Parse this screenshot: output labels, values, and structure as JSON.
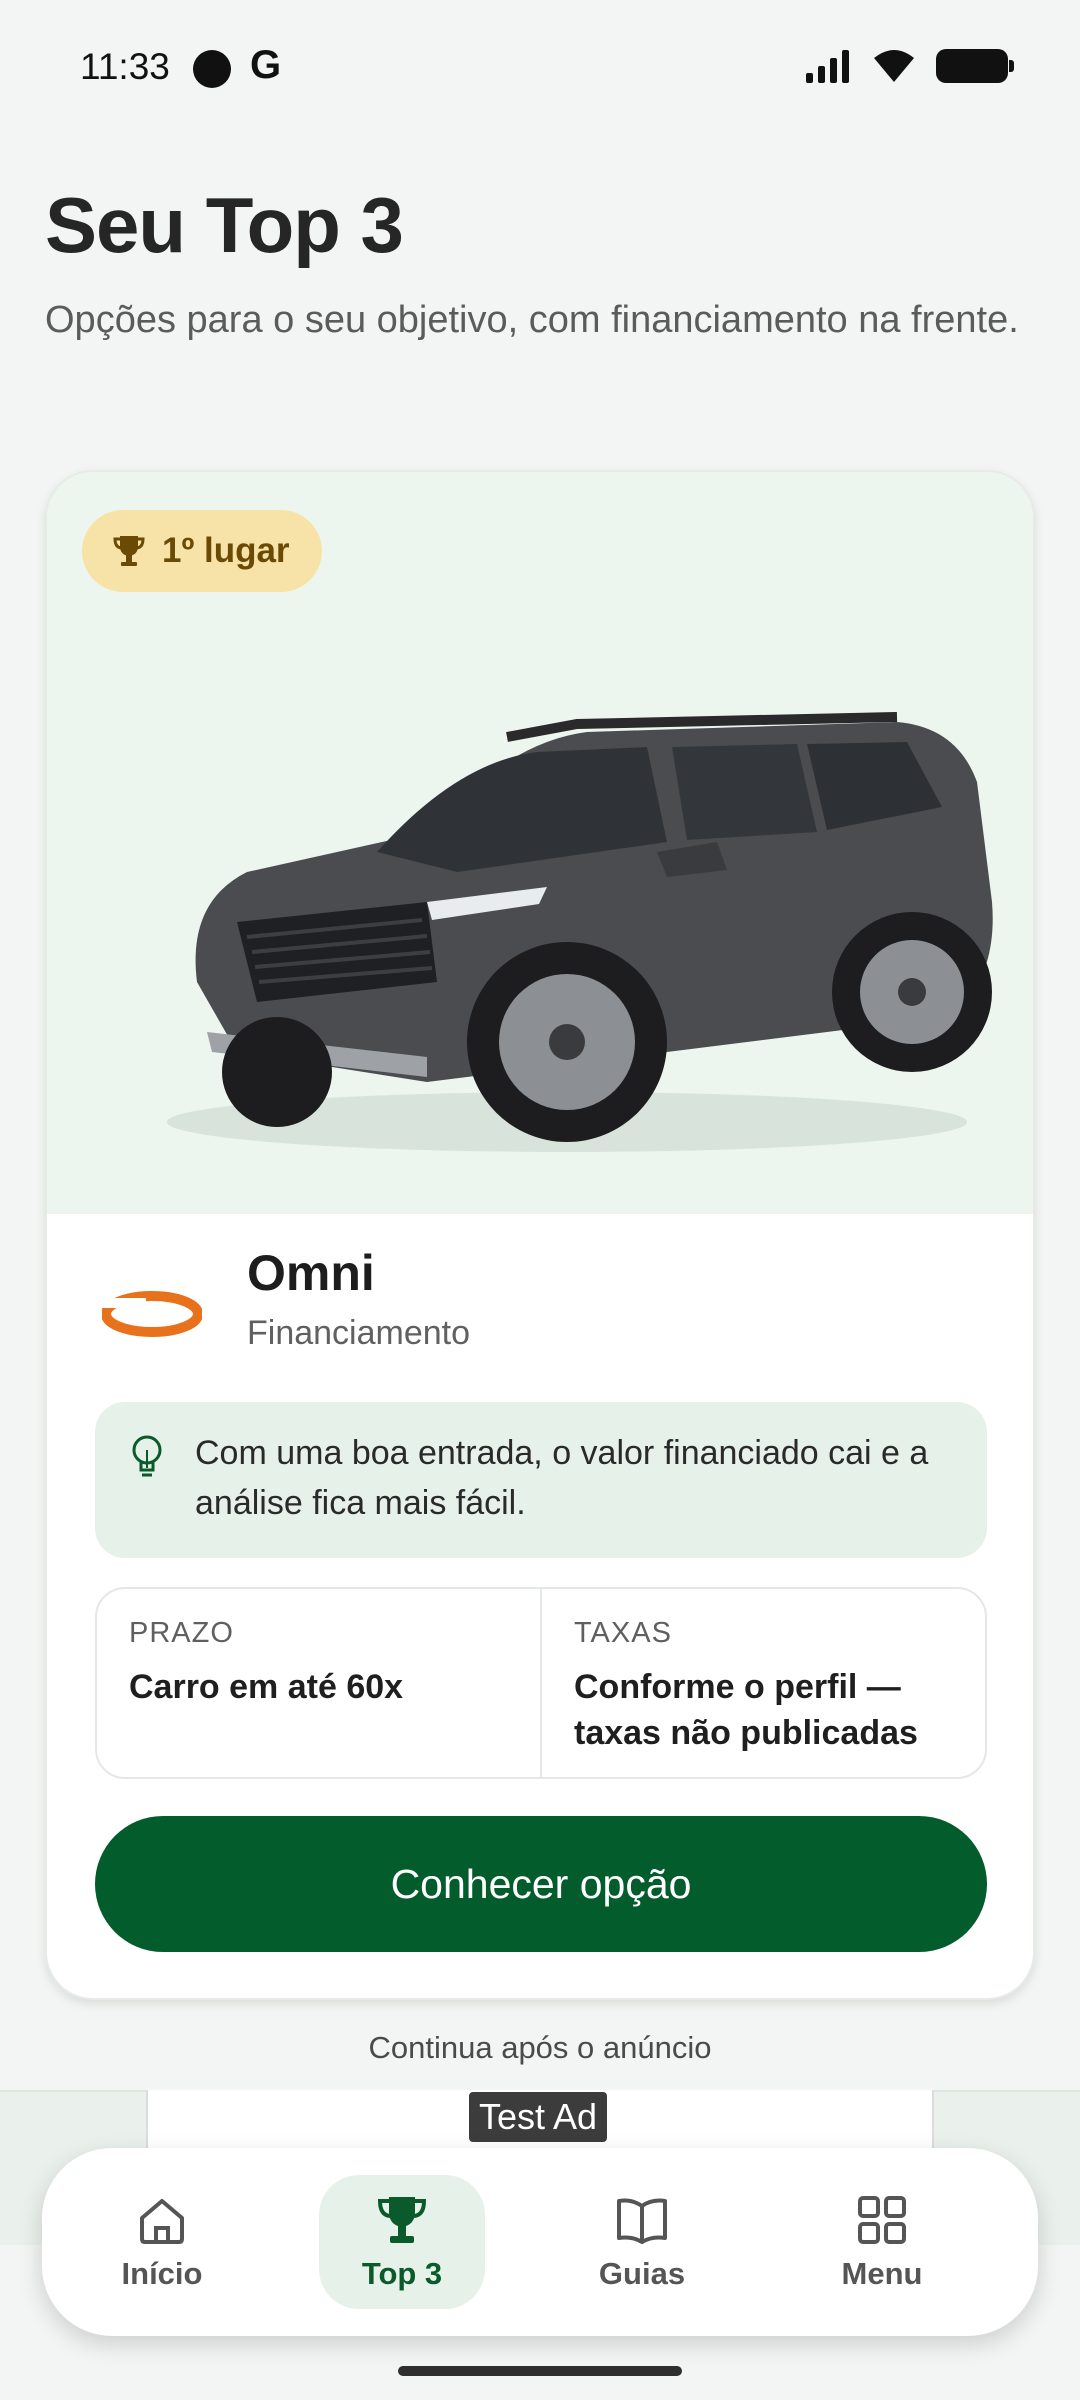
{
  "status_bar": {
    "time": "11:33",
    "g_label": "G"
  },
  "header": {
    "title": "Seu Top 3",
    "subtitle": "Opções para o seu objetivo, com financiamento na frente."
  },
  "card": {
    "rank_badge": "1º lugar",
    "car_image_icon": "suv-car-image",
    "provider_name": "Omni",
    "provider_type": "Financiamento",
    "tip": "Com uma boa entrada, o valor financiado cai e a análise fica mais fácil.",
    "info": [
      {
        "label": "PRAZO",
        "value": "Carro em até 60x"
      },
      {
        "label": "TAXAS",
        "value": "Conforme o perfil — taxas não publicadas"
      }
    ],
    "cta_label": "Conhecer opção"
  },
  "continue_note": "Continua após o anúncio",
  "ad": {
    "label": "Test Ad"
  },
  "nav": {
    "items": [
      {
        "label": "Início",
        "icon": "home-icon"
      },
      {
        "label": "Top 3",
        "icon": "trophy-icon"
      },
      {
        "label": "Guias",
        "icon": "book-icon"
      },
      {
        "label": "Menu",
        "icon": "grid-icon"
      }
    ]
  },
  "colors": {
    "brand_green": "#035c2c",
    "badge_gold": "#f7e3a8",
    "hero_bg": "#edf5ef",
    "omni_orange": "#e8711c"
  }
}
